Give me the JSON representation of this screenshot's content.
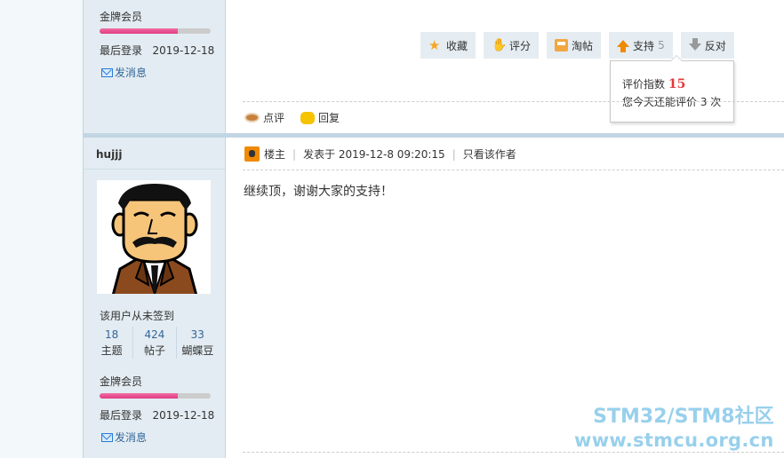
{
  "prev_user": {
    "level": "金牌会员",
    "level_progress": 0.7,
    "last_login_label": "最后登录",
    "last_login": "2019-12-18",
    "send_message": "发消息"
  },
  "actions": [
    {
      "label": "收藏",
      "icon": "star-icon",
      "count": ""
    },
    {
      "label": "评分",
      "icon": "thumb-icon",
      "count": ""
    },
    {
      "label": "淘帖",
      "icon": "tray-icon",
      "count": ""
    },
    {
      "label": "支持",
      "icon": "up-arrow-icon",
      "count": "5"
    },
    {
      "label": "反对",
      "icon": "down-arrow-icon",
      "count": ""
    }
  ],
  "tooltip": {
    "score_label": "评价指数",
    "score": "15",
    "remaining": "您今天还能评价 3 次"
  },
  "reply_bar": {
    "comment": "点评",
    "reply": "回复"
  },
  "user": {
    "name": "hujjj",
    "signin": "该用户从未签到",
    "stats": [
      {
        "num": "18",
        "label": "主题"
      },
      {
        "num": "424",
        "label": "帖子"
      },
      {
        "num": "33",
        "label": "蝴蝶豆"
      }
    ],
    "level": "金牌会员",
    "level_progress": 0.7,
    "last_login_label": "最后登录",
    "last_login": "2019-12-18",
    "send_message": "发消息"
  },
  "post": {
    "floor": "楼主",
    "posted_at": "发表于 2019-12-8 09:20:15",
    "only_author": "只看该作者",
    "body": "继续顶，谢谢大家的支持！"
  },
  "watermark": {
    "line1": "STM32/STM8社区",
    "line2": "www.stmcu.org.cn"
  },
  "colors": {
    "sidebar_bg": "#e3ecf2",
    "link": "#336699",
    "level_bar": "#e03b83",
    "score": "#e4393c",
    "watermark": "#7fc5e8"
  }
}
